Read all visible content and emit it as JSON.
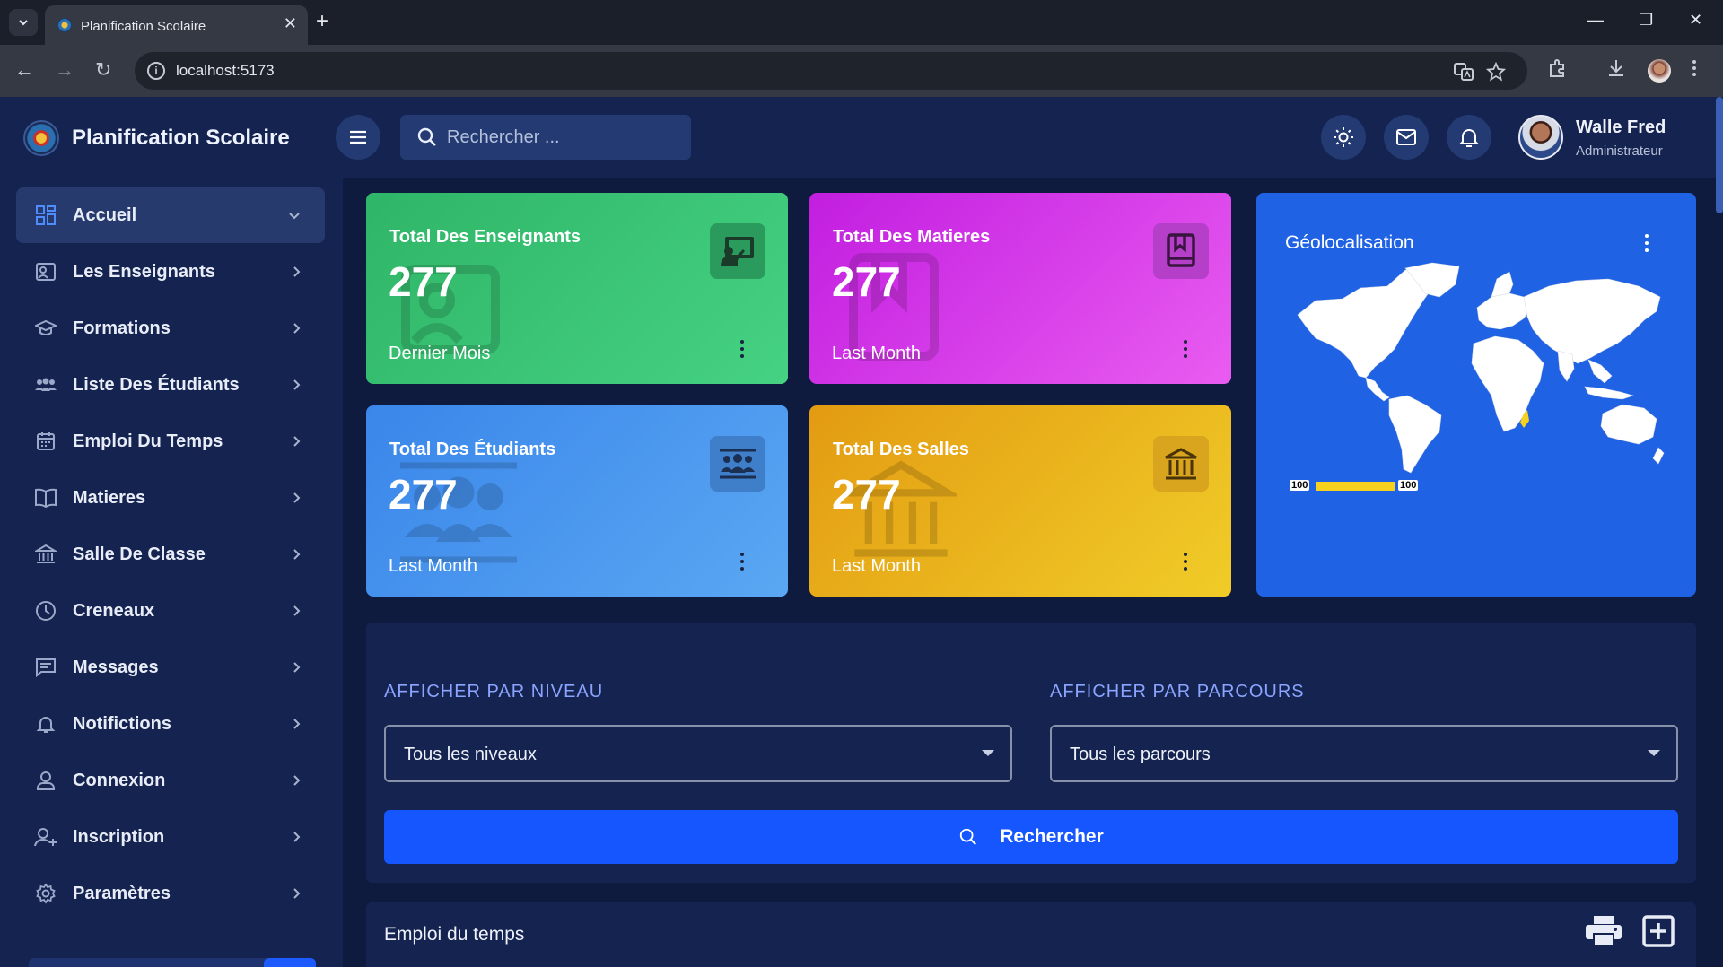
{
  "browser": {
    "tab_title": "Planification Scolaire",
    "tab_close": "✕",
    "new_tab": "+",
    "url": "localhost:5173",
    "controls": {
      "minimize": "—",
      "restore": "❐",
      "close": "✕"
    },
    "nav": {
      "back": "←",
      "forward": "→",
      "reload": "↻"
    }
  },
  "app": {
    "brand": "Planification Scolaire",
    "search": {
      "placeholder": "Rechercher ..."
    },
    "user": {
      "name": "Walle Fred",
      "role": "Administrateur"
    }
  },
  "sidebar": {
    "items": [
      {
        "label": "Accueil",
        "icon": "dashboard-icon",
        "active": true
      },
      {
        "label": "Les Enseignants",
        "icon": "teacher-icon"
      },
      {
        "label": "Formations",
        "icon": "graduation-cap-icon"
      },
      {
        "label": "Liste Des Étudiants",
        "icon": "students-icon"
      },
      {
        "label": "Emploi Du Temps",
        "icon": "calendar-icon"
      },
      {
        "label": "Matieres",
        "icon": "book-icon"
      },
      {
        "label": "Salle De Classe",
        "icon": "building-icon"
      },
      {
        "label": "Creneaux",
        "icon": "clock-icon"
      },
      {
        "label": "Messages",
        "icon": "message-icon"
      },
      {
        "label": "Notifictions",
        "icon": "bell-icon"
      },
      {
        "label": "Connexion",
        "icon": "user-icon"
      },
      {
        "label": "Inscription",
        "icon": "user-plus-icon"
      },
      {
        "label": "Paramètres",
        "icon": "gear-icon"
      }
    ]
  },
  "cards": [
    {
      "title": "Total Des Enseignants",
      "value": "277",
      "sub": "Dernier Mois",
      "icon": "teacher-board-icon",
      "colors": [
        "#2fb567",
        "#46d283"
      ]
    },
    {
      "title": "Total Des Matieres",
      "value": "277",
      "sub": "Last Month",
      "icon": "book-icon",
      "colors": [
        "#c21ee0",
        "#e95cf0"
      ]
    },
    {
      "title": "Total Des Étudiants",
      "value": "277",
      "sub": "Last Month",
      "icon": "students-icon",
      "colors": [
        "#3a86ea",
        "#5aa7f3"
      ]
    },
    {
      "title": "Total Des Salles",
      "value": "277",
      "sub": "Last Month",
      "icon": "building-icon",
      "colors": [
        "#e39b12",
        "#f0cc28"
      ]
    }
  ],
  "geo": {
    "title": "Géolocalisation",
    "legend_min": "100",
    "legend_max": "100",
    "legend_color": "#f6d21e"
  },
  "filters": {
    "niveau_label": "AFFICHER PAR NIVEAU",
    "niveau_value": "Tous les niveaux",
    "parcours_label": "AFFICHER PAR PARCOURS",
    "parcours_value": "Tous les parcours",
    "search_button": "Rechercher"
  },
  "timetable": {
    "title": "Emploi du temps"
  },
  "colors": {
    "accent": "#1556ff",
    "label": "#8aa4ff",
    "sidebar": "#14234f",
    "page": "#0e1a3e"
  }
}
